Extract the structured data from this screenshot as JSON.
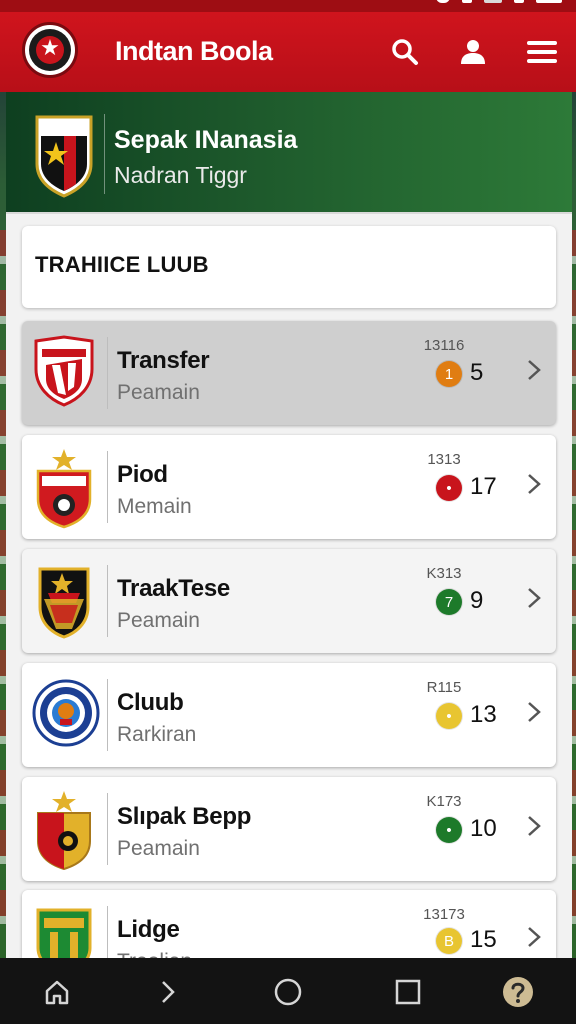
{
  "app": {
    "title": "Indtan Boola"
  },
  "header": {
    "icons": [
      "search-icon",
      "user-icon",
      "menu-icon"
    ]
  },
  "banner": {
    "title": "Sepak INanasia",
    "subtitle": "Nadran Tiggr"
  },
  "section": {
    "title": "TRAHIICE LUUB"
  },
  "rows": [
    {
      "name": "Transfer",
      "sub": "Peamain",
      "code": "13116",
      "badge": "1",
      "badge_color": "#e07d12",
      "value": "5",
      "crest_color": "#c8141c"
    },
    {
      "name": "Piod",
      "sub": "Memain",
      "code": "1313",
      "badge": "•",
      "badge_color": "#c8141c",
      "value": "17",
      "crest_color": "#d01a1f"
    },
    {
      "name": "TraakTese",
      "sub": "Peamain",
      "code": "K313",
      "badge": "7",
      "badge_color": "#1d7a2a",
      "value": "9",
      "crest_color": "#111111"
    },
    {
      "name": "Cluub",
      "sub": "Rarkiran",
      "code": "R115",
      "badge": "•",
      "badge_color": "#e8c531",
      "value": "13",
      "crest_color": "#1c3f93"
    },
    {
      "name": "Slıpak Bepp",
      "sub": "Peamain",
      "code": "K173",
      "badge": "•",
      "badge_color": "#1d7a2a",
      "value": "10",
      "crest_color": "#c8141c"
    },
    {
      "name": "Lidge",
      "sub": "Treolian",
      "code": "13173",
      "badge": "B",
      "badge_color": "#e8c531",
      "value": "15",
      "crest_color": "#1d8a33"
    }
  ],
  "bottom_nav": {
    "icons": [
      "home-icon",
      "back-icon",
      "circle-home-icon",
      "recents-icon",
      "help-icon"
    ]
  },
  "colors": {
    "primary": "#c8141c",
    "banner": "#1e5a2c",
    "nav": "#131313"
  }
}
